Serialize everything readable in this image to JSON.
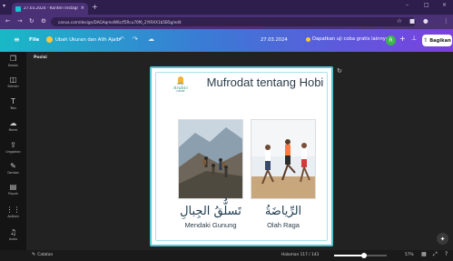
{
  "browser": {
    "tab_title": "27.03.2024 - Konten Instagram",
    "tab_close": "×",
    "new_tab": "+",
    "url": "canva.com/design/DAGAqmoW6c/f5Rcu70f6_2YIRXX1b5B5g/edit",
    "window_controls": [
      "–",
      "□",
      "×"
    ]
  },
  "toolbar": {
    "menu_icon": "≡",
    "file_label": "File",
    "resize_label": "Ubah Ukuran dan Alih Ajaib",
    "date_label": "27.03.2024",
    "trial_label": "Dapatkan uji coba gratis lainnya",
    "avatar_initial": "R",
    "plus": "+",
    "share_label": "Bagikan",
    "colors": {
      "gradient_start": "#19b9c6",
      "gradient_end": "#7b3fe0",
      "crown": "#ffc53d",
      "avatar": "#3bb54a"
    }
  },
  "sidebar": {
    "items": [
      {
        "icon": "❒",
        "label": "Desain"
      },
      {
        "icon": "◫",
        "label": "Elemen"
      },
      {
        "icon": "T",
        "label": "Teks"
      },
      {
        "icon": "☁",
        "label": "Merek"
      },
      {
        "icon": "⇪",
        "label": "Unggahan"
      },
      {
        "icon": "✎",
        "label": "Gambar"
      },
      {
        "icon": "▤",
        "label": "Proyek"
      },
      {
        "icon": "⋮⋮",
        "label": "Aplikasi"
      },
      {
        "icon": "♫",
        "label": "Audio"
      },
      {
        "icon": "☆",
        "label": ""
      }
    ]
  },
  "canvas": {
    "position_label": "Posisi",
    "rotate_icon": "↻",
    "magic_icon": "✦"
  },
  "design": {
    "brand_name": "Arabic",
    "brand_prefix": "KAMAL",
    "brand_sub": "COURSE",
    "title": "Mufrodat tentang Hobi",
    "items": [
      {
        "arabic": "تَسلُّقُ الجِبالِ",
        "latin": "Mendaki Gunung"
      },
      {
        "arabic": "الرِّياضَةُ",
        "latin": "Olah Raga"
      }
    ],
    "colors": {
      "border": "#55c7d4",
      "title": "#2b3d4a",
      "brand": "#1e9a6b"
    }
  },
  "bottombar": {
    "notes_label": "Catatan",
    "page_label": "Halaman 117 / 143",
    "zoom_label": "57%",
    "zoom_fraction": 0.57
  }
}
